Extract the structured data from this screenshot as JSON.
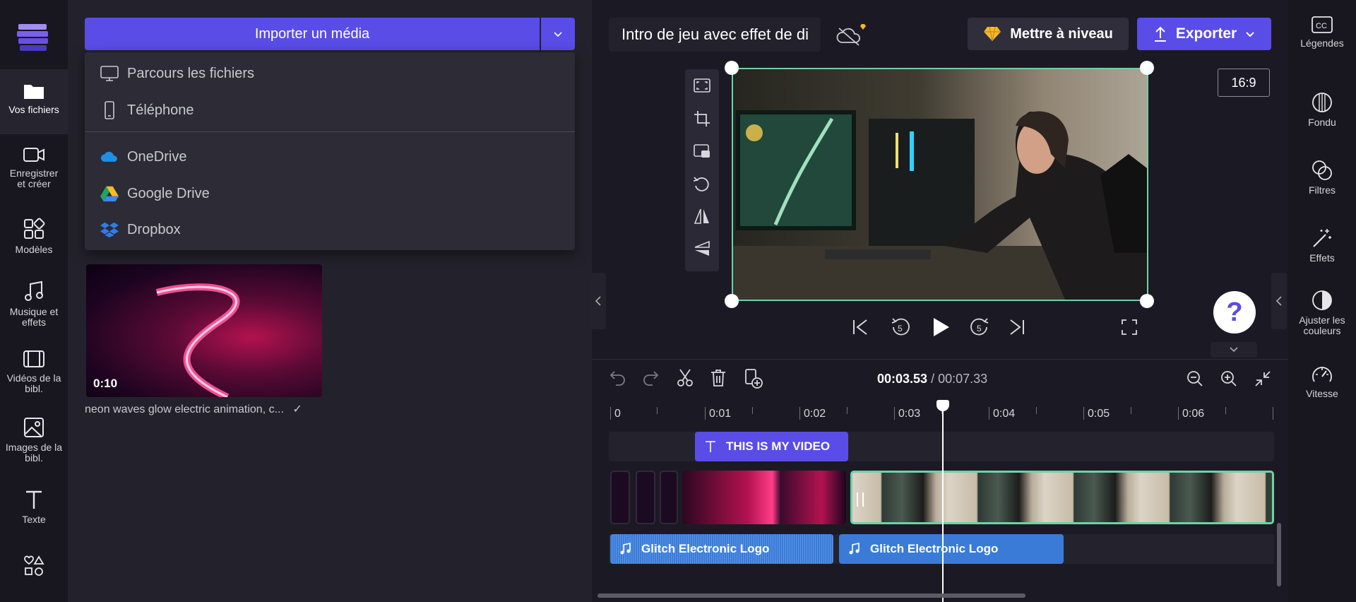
{
  "left_nav": {
    "items": [
      {
        "label": "Vos fichiers",
        "icon": "folder-icon"
      },
      {
        "label": "Enregistrer et créer",
        "icon": "camera-icon"
      },
      {
        "label": "Modèles",
        "icon": "templates-icon"
      },
      {
        "label": "Musique et effets",
        "icon": "music-icon"
      },
      {
        "label": "Vidéos de la bibl.",
        "icon": "film-icon"
      },
      {
        "label": "Images de la bibl.",
        "icon": "image-icon"
      },
      {
        "label": "Texte",
        "icon": "text-icon"
      },
      {
        "label": "",
        "icon": "shapes-icon"
      }
    ]
  },
  "media_panel": {
    "import_label": "Importer un média",
    "dropdown": [
      {
        "label": "Parcours les fichiers",
        "icon": "monitor-icon"
      },
      {
        "label": "Téléphone",
        "icon": "phone-icon"
      },
      {
        "label": "OneDrive",
        "icon": "onedrive-icon"
      },
      {
        "label": "Google Drive",
        "icon": "google-drive-icon"
      },
      {
        "label": "Dropbox",
        "icon": "dropbox-icon"
      }
    ],
    "asset": {
      "duration": "0:10",
      "name": "neon waves glow electric animation, c...",
      "status": "✓"
    }
  },
  "header": {
    "project_title": "Intro de jeu avec effet de di",
    "upgrade_label": "Mettre à niveau",
    "export_label": "Exporter"
  },
  "preview": {
    "aspect_ratio": "16:9",
    "help": "?"
  },
  "timeline": {
    "current_time": "00:03.53",
    "separator": " / ",
    "total_time": "00:07.33",
    "ruler": [
      "0",
      "0:01",
      "0:02",
      "0:03",
      "0:04",
      "0:05",
      "0:06"
    ],
    "text_clip": "THIS IS MY VIDEO",
    "audio_clips": [
      "Glitch Electronic Logo",
      "Glitch Electronic Logo"
    ]
  },
  "right_nav": {
    "items": [
      {
        "label": "Légendes",
        "icon": "captions-icon"
      },
      {
        "label": "Fondu",
        "icon": "fade-icon"
      },
      {
        "label": "Filtres",
        "icon": "filters-icon"
      },
      {
        "label": "Effets",
        "icon": "effects-icon"
      },
      {
        "label": "Ajuster les couleurs",
        "icon": "color-adjust-icon"
      },
      {
        "label": "Vitesse",
        "icon": "speed-icon"
      }
    ]
  },
  "colors": {
    "accent": "#5a4ce6",
    "selection": "#6fd1a6",
    "audio": "#3a7bd8"
  }
}
